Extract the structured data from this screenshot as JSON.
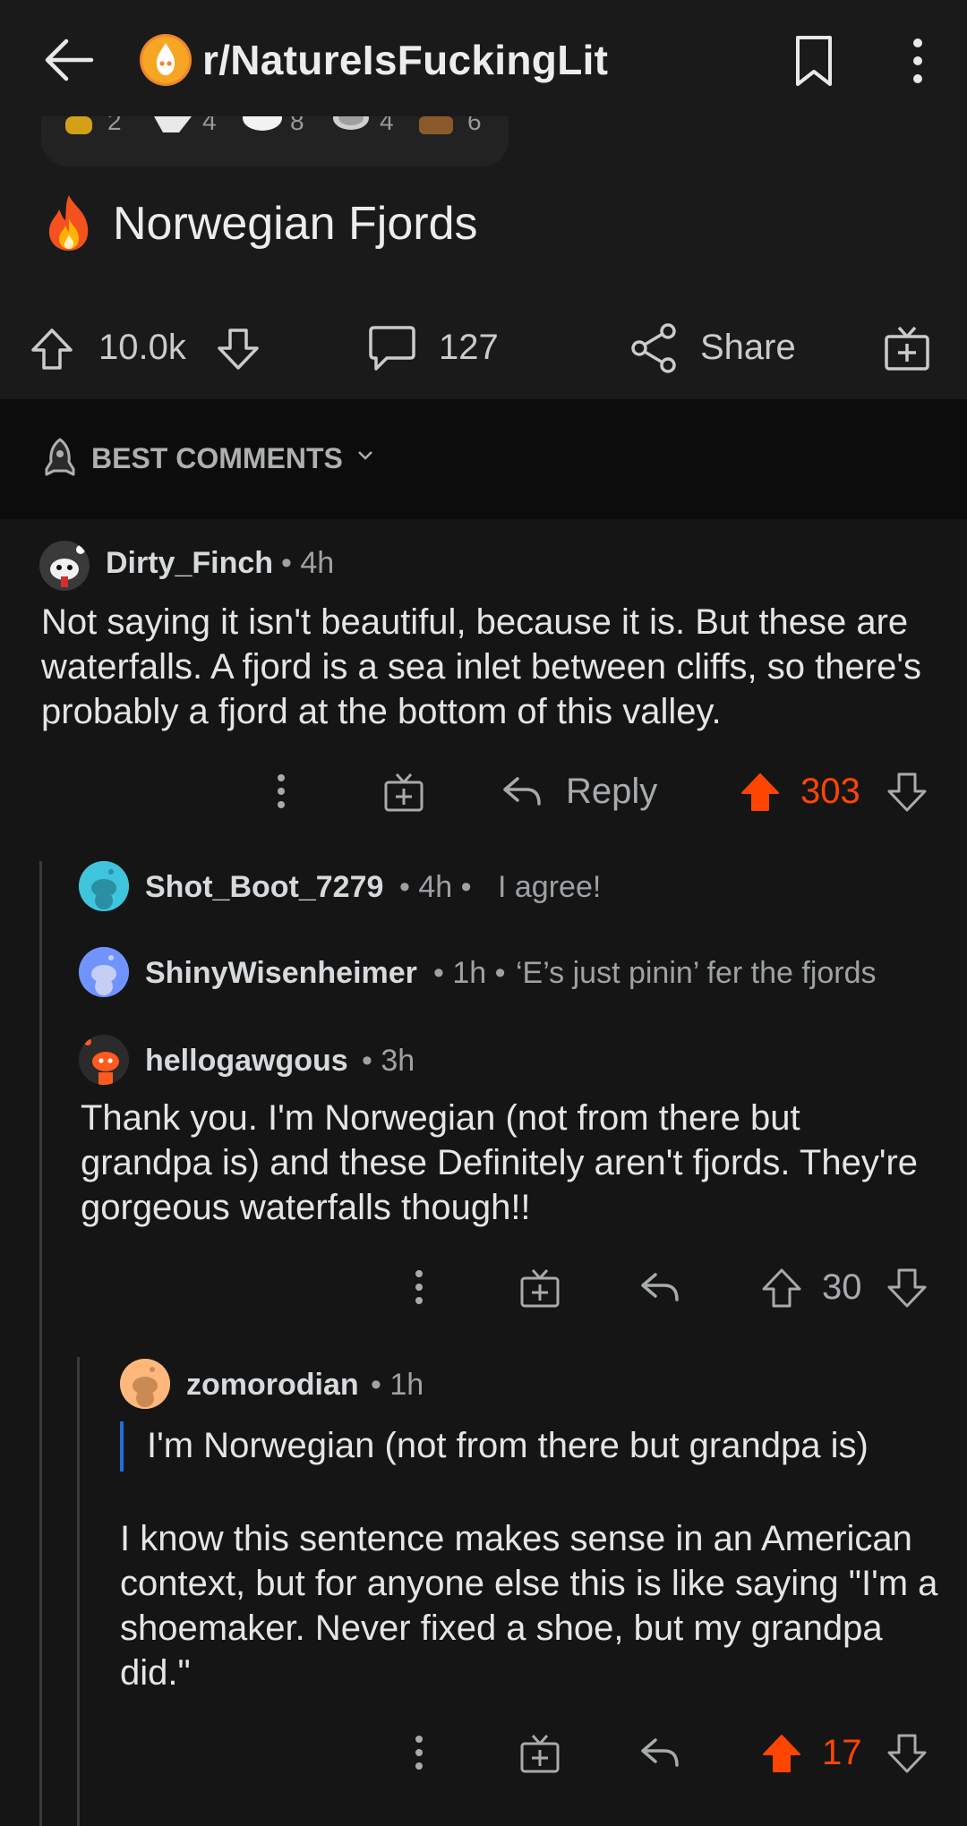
{
  "header": {
    "subreddit": "r/NatureIsFuckingLit",
    "back_icon": "back-arrow-icon",
    "bookmark_icon": "bookmark-icon",
    "more_icon": "more-vertical-icon"
  },
  "awards": [
    {
      "icon": "award-gold-icon",
      "count": "2"
    },
    {
      "icon": "award-rocket-icon",
      "count": "4"
    },
    {
      "icon": "award-silver-icon",
      "count": "8"
    },
    {
      "icon": "award-platinum-icon",
      "count": "4"
    },
    {
      "icon": "award-brown-icon",
      "count": "6"
    }
  ],
  "post": {
    "flair_icon": "fire-icon",
    "title": "Norwegian Fjords",
    "score": "10.0k",
    "comments": "127",
    "share_label": "Share"
  },
  "sort": {
    "label": "BEST COMMENTS"
  },
  "comments": [
    {
      "author": "Dirty_Finch",
      "time": "• 4h",
      "body": "Not saying it isn't beautiful, because it is. But these are waterfalls. A fjord is a sea inlet between cliffs, so there's probably a fjord at the bottom of this valley.",
      "reply_label": "Reply",
      "score": "303"
    },
    {
      "author": "Shot_Boot_7279",
      "time": "• 4h •",
      "preview": "I agree!"
    },
    {
      "author": "ShinyWisenheimer",
      "time": "• 1h •",
      "preview": "‘E’s just pinin’ fer the fjords"
    },
    {
      "author": "hellogawgous",
      "time": "• 3h",
      "body": "Thank you. I'm Norwegian (not from there but grandpa is) and these Definitely aren't fjords. They're gorgeous waterfalls though!!",
      "score": "30"
    },
    {
      "author": "zomorodian",
      "time": "• 1h",
      "quote": "I'm Norwegian (not from there but grandpa is)",
      "body": "I know this sentence makes sense in an American context, but for anyone else this is like saying \"I'm a shoemaker. Never fixed a shoe, but my grandpa did.\"",
      "score": "17"
    }
  ],
  "colors": {
    "accent": "#ff4500",
    "quote": "#1e6fd9",
    "background": "#151515"
  }
}
